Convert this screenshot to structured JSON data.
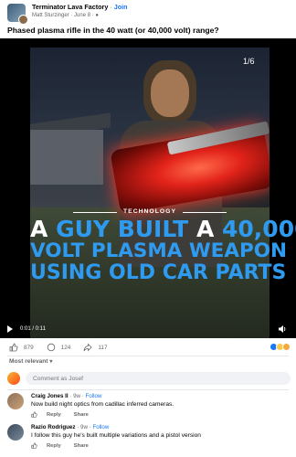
{
  "post": {
    "group_name": "Terminator Lava Factory",
    "join_label": "Join",
    "author": "Matt Sturzinger",
    "date": "June 8",
    "text": "Phased plasma rifle in the 40 watt (or 40,000 volt) range?"
  },
  "video": {
    "slide_counter": "1/6",
    "tech_label": "TECHNOLOGY",
    "headline": {
      "row1": [
        "A",
        "GUY BUILT",
        "A",
        "40,000"
      ],
      "row2": [
        "VOLT PLASMA WEAPON"
      ],
      "row3": [
        "USING OLD",
        "CAR PARTS"
      ]
    },
    "time": "0:01 / 0:11"
  },
  "reactions": {
    "like_count": "879",
    "comment_count": "124",
    "share_count": "117"
  },
  "sort_label": "Most relevant",
  "comment_input": {
    "placeholder": "Comment as Josef"
  },
  "comments": [
    {
      "author": "Craig Jones II",
      "time": "9w",
      "follow": "Follow",
      "text": "Now build night optics from cadillac inferred cameras.",
      "reply_label": "Reply",
      "share_label": "Share"
    },
    {
      "author": "Razio Rodriguez",
      "time": "9w",
      "follow": "Follow",
      "text": "I follow this guy he's built multiple variations and a pistol version",
      "reply_label": "Reply",
      "share_label": "Share"
    }
  ],
  "colors": {
    "accent": "#1877f2",
    "headline_blue": "#2f9bf0"
  }
}
